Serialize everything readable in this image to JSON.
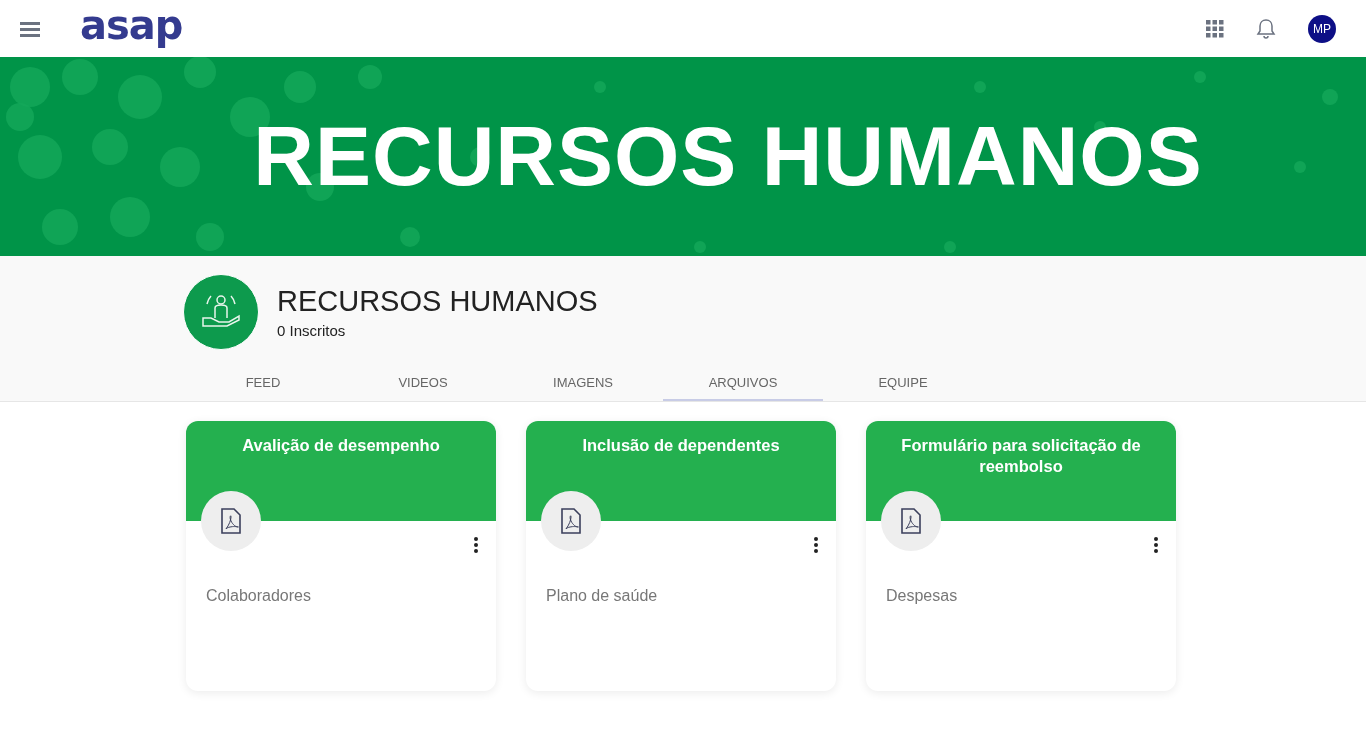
{
  "header": {
    "logo": "asap",
    "avatar": "MP"
  },
  "banner": {
    "title": "RECURSOS HUMANOS"
  },
  "channel": {
    "name": "RECURSOS HUMANOS",
    "subscribers": "0 Inscritos"
  },
  "tabs": [
    {
      "label": "FEED",
      "selected": false
    },
    {
      "label": "VIDEOS",
      "selected": false
    },
    {
      "label": "IMAGENS",
      "selected": false
    },
    {
      "label": "ARQUIVOS",
      "selected": true
    },
    {
      "label": "EQUIPE",
      "selected": false
    }
  ],
  "files": [
    {
      "title": "Avalição de desempenho",
      "category": "Colaboradores"
    },
    {
      "title": "Inclusão de dependentes",
      "category": "Plano de saúde"
    },
    {
      "title": "Formulário para solicitação de reembolso",
      "category": "Despesas"
    }
  ]
}
